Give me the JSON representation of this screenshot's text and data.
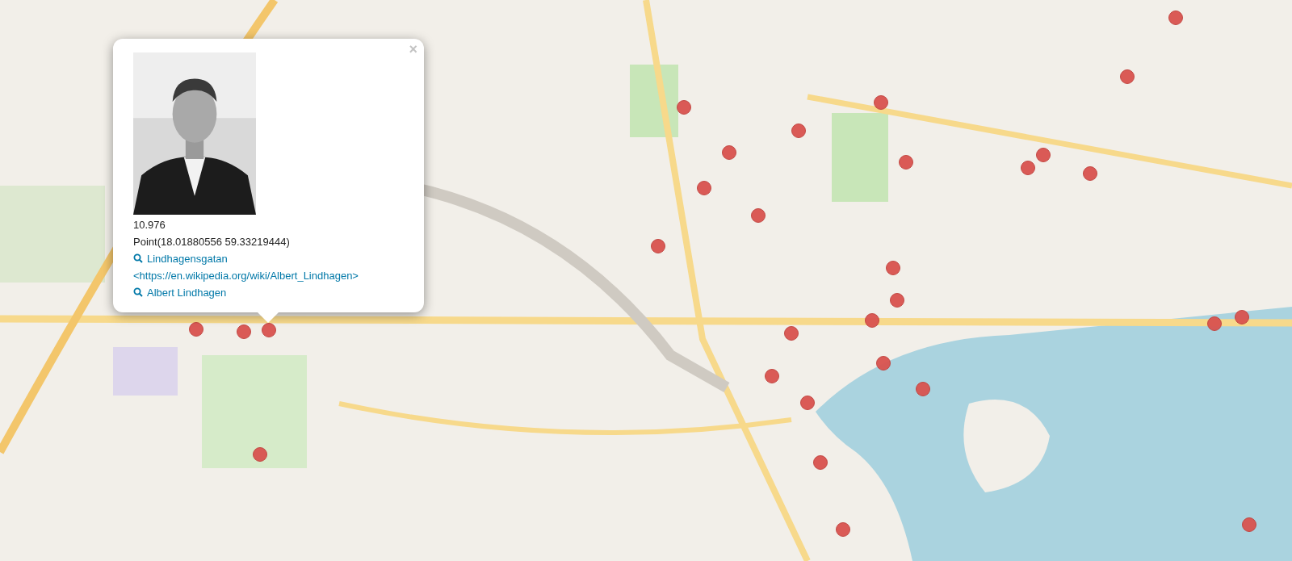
{
  "popup": {
    "close": "×",
    "lines": [
      "10.976",
      "Point(18.01880556 59.33219444)"
    ],
    "links": [
      "Lindhagensgatan <https://en.wikipedia.org/wiki/Albert_Lindhagen>",
      "Albert Lindhagen"
    ]
  }
}
